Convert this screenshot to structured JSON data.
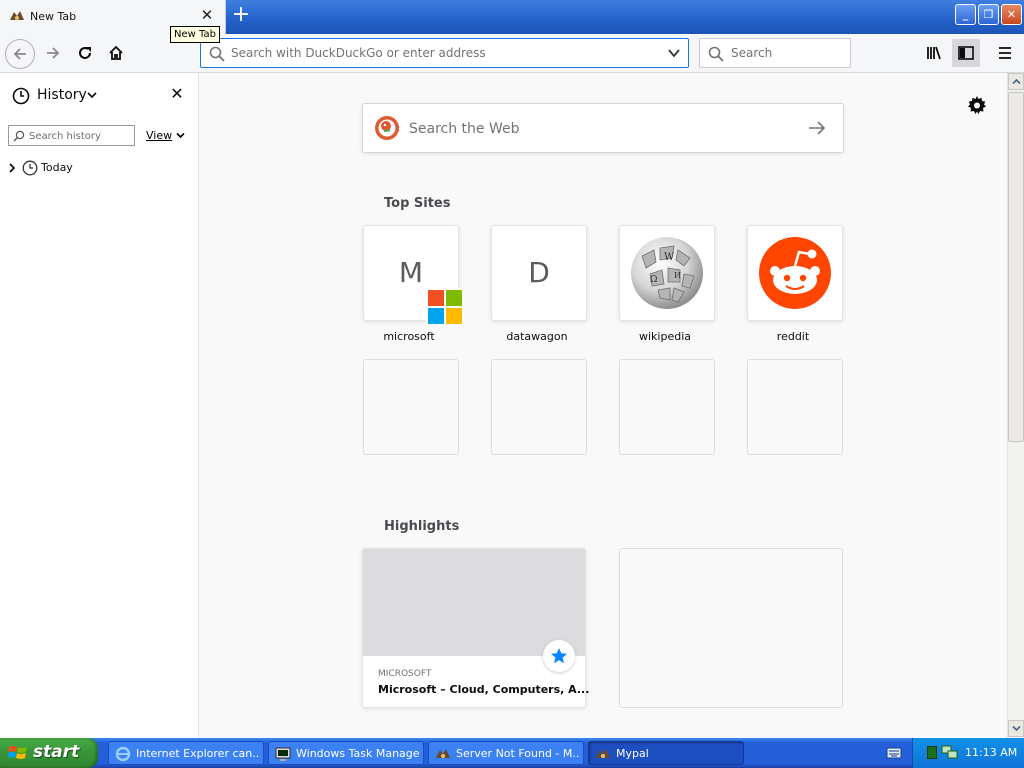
{
  "browser": {
    "tab": {
      "title": "New Tab",
      "close_glyph": "✕",
      "favicon": "mypal-icon"
    },
    "tooltip": "New Tab",
    "new_tab_glyph": "+",
    "window_controls": {
      "minimize": "_",
      "maximize": "❐",
      "close": "✕"
    },
    "toolbar": {
      "address_placeholder": "Search with DuckDuckGo or enter address",
      "search_placeholder": "Search"
    },
    "sidebar": {
      "title": "History",
      "close_glyph": "✕",
      "search_placeholder": "Search history",
      "view_label": "View",
      "groups": [
        {
          "label": "Today"
        }
      ]
    },
    "newtab": {
      "web_search_placeholder": "Search the Web",
      "top_sites_title": "Top Sites",
      "top_sites": [
        {
          "label": "microsoft",
          "letter": "M"
        },
        {
          "label": "datawagon",
          "letter": "D"
        },
        {
          "label": "wikipedia"
        },
        {
          "label": "reddit"
        }
      ],
      "highlights_title": "Highlights",
      "highlights": [
        {
          "source": "MICROSOFT",
          "title": "Microsoft – Cloud, Computers, A..."
        }
      ]
    }
  },
  "taskbar": {
    "start_label": "start",
    "tasks": [
      {
        "label": "Internet Explorer can...",
        "icon": "ie-icon"
      },
      {
        "label": "Windows Task Manager",
        "icon": "task-manager-icon"
      },
      {
        "label": "Server Not Found - M...",
        "icon": "mypal-icon"
      },
      {
        "label": "Mypal",
        "icon": "mypal-icon",
        "active": true
      }
    ],
    "clock": "11:13 AM"
  },
  "colors": {
    "accent": "#0a84ff",
    "xp_blue": "#245edb",
    "start_green": "#3b973b",
    "reddit_orange": "#ff4500",
    "ddg_orange": "#de5833"
  }
}
